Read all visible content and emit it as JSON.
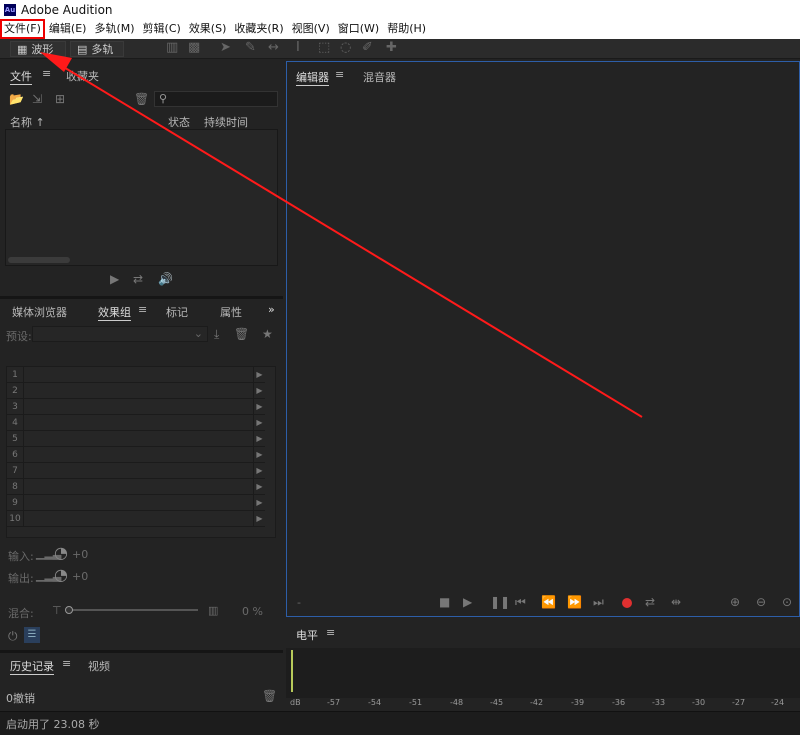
{
  "title": "Adobe Audition",
  "menu": [
    "文件(F)",
    "编辑(E)",
    "多轨(M)",
    "剪辑(C)",
    "效果(S)",
    "收藏夹(R)",
    "视图(V)",
    "窗口(W)",
    "帮助(H)"
  ],
  "toolbar": {
    "waveform": "波形",
    "multitrack": "多轨"
  },
  "files_panel": {
    "tab_files": "文件",
    "tab_favorites": "收藏夹",
    "col_name": "名称",
    "col_status": "状态",
    "col_duration": "持续时间"
  },
  "effects_panel": {
    "tabs": [
      "媒体浏览器",
      "效果组",
      "标记",
      "属性"
    ],
    "preset_label": "预设:",
    "rows": [
      "1",
      "2",
      "3",
      "4",
      "5",
      "6",
      "7",
      "8",
      "9",
      "10"
    ],
    "input_label": "输入:",
    "input_value": "+0",
    "output_label": "输出:",
    "output_value": "+0",
    "mix_label": "混合:",
    "mix_value": "0 %"
  },
  "history_panel": {
    "tab_history": "历史记录",
    "tab_video": "视频",
    "undo_text": "0撤销"
  },
  "editor_panel": {
    "tab_editor": "编辑器",
    "tab_mixer": "混音器"
  },
  "level_panel": {
    "title": "电平",
    "ticks": [
      "dB",
      "-57",
      "-54",
      "-51",
      "-48",
      "-45",
      "-42",
      "-39",
      "-36",
      "-33",
      "-30",
      "-27",
      "-24"
    ]
  },
  "status_bar": "启动用了 23.08 秒",
  "colors": {
    "record": "#e03030",
    "annotation": "#ff1a1a",
    "editor_border": "#2d5ea8"
  }
}
